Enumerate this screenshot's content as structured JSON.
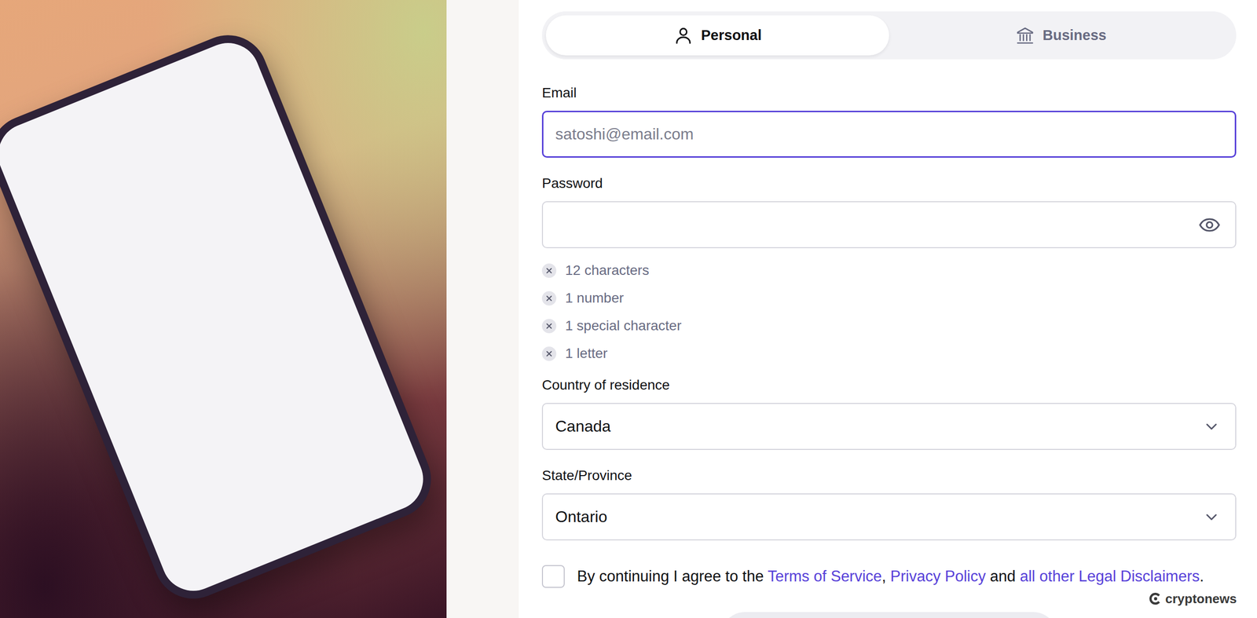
{
  "tabs": [
    {
      "label": "Personal",
      "selected": true,
      "icon": "person"
    },
    {
      "label": "Business",
      "selected": false,
      "icon": "bank"
    }
  ],
  "fields": [
    {
      "kind": "text",
      "label": "Email",
      "placeholder": "satoshi@email.com",
      "value": "",
      "focused": true
    },
    {
      "kind": "password",
      "label": "Password",
      "placeholder": "",
      "value": "",
      "focused": false
    }
  ],
  "password_rules": [
    {
      "text": "12 characters",
      "met": false
    },
    {
      "text": "1 number",
      "met": false
    },
    {
      "text": "1 special character",
      "met": false
    },
    {
      "text": "1 letter",
      "met": false
    }
  ],
  "selects": [
    {
      "label": "Country of residence",
      "value": "Canada"
    },
    {
      "label": "State/Province",
      "value": "Ontario"
    }
  ],
  "agreement": {
    "checked": false,
    "parts": [
      {
        "kind": "text",
        "text": "By continuing I agree to the "
      },
      {
        "kind": "link",
        "text": "Terms of Service"
      },
      {
        "kind": "text",
        "text": ", "
      },
      {
        "kind": "link",
        "text": "Privacy Policy"
      },
      {
        "kind": "text",
        "text": " and "
      },
      {
        "kind": "link",
        "text": "all other Legal Disclaimers"
      },
      {
        "kind": "text",
        "text": "."
      }
    ]
  },
  "watermark": "cryptonews"
}
